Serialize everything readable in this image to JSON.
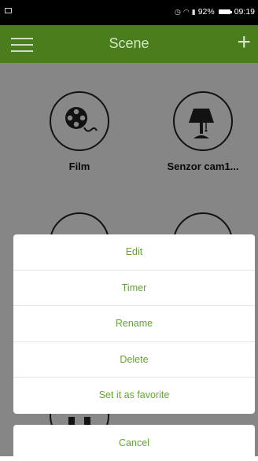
{
  "status_bar": {
    "battery_percent": "92%",
    "time": "09:19",
    "icons": [
      "notification-icon",
      "alarm-icon",
      "wifi-icon",
      "signal-icon",
      "battery-icon"
    ]
  },
  "app_bar": {
    "title": "Scene",
    "menu_icon": "hamburger-menu-icon",
    "add_icon": "plus-icon",
    "color": "#4a7d1c"
  },
  "scenes": [
    {
      "label": "Film",
      "icon": "film-reel-icon"
    },
    {
      "label": "Senzor cam1...",
      "icon": "lamp-icon"
    },
    {
      "label": "",
      "icon": "scene-icon"
    },
    {
      "label": "",
      "icon": "scene-icon"
    },
    {
      "label": "",
      "icon": "socket-icon"
    }
  ],
  "action_sheet": {
    "items": [
      "Edit",
      "Timer",
      "Rename",
      "Delete",
      "Set it as favorite"
    ],
    "cancel": "Cancel",
    "accent_color": "#64a431"
  }
}
